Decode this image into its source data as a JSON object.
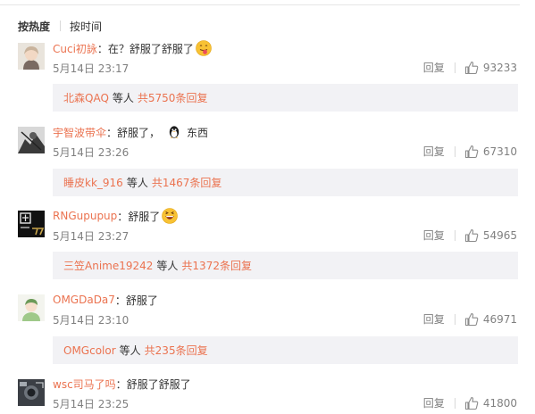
{
  "sort": {
    "hot_label": "按热度",
    "time_label": "按时间"
  },
  "colors": {
    "accent": "#eb7350",
    "text": "#333333",
    "meta": "#808080",
    "subbox_bg": "#f2f2f5"
  },
  "comments": [
    {
      "username": "Cuci初詠",
      "text": "：在？舒服了舒服了",
      "emoji": "tongue-out-emoji",
      "time": "5月14日 23:17",
      "reply_label": "回复",
      "likes": "93233",
      "sub": {
        "user": "北森QAQ",
        "deng": "等人",
        "total": "共5750条回复"
      }
    },
    {
      "username": "宇智波带伞",
      "text": "：舒服了，",
      "emoji": "qq-penguin-icon",
      "text_after": "东西",
      "time": "5月14日 23:26",
      "reply_label": "回复",
      "likes": "67310",
      "sub": {
        "user": "睡皮kk_916",
        "deng": "等人",
        "total": "共1467条回复"
      }
    },
    {
      "username": "RNGupupup",
      "text": "：舒服了",
      "emoji": "laughing-emoji",
      "time": "5月14日 23:27",
      "reply_label": "回复",
      "likes": "54965",
      "sub": {
        "user": "三笠Anime19242",
        "deng": "等人",
        "total": "共1372条回复"
      }
    },
    {
      "username": "OMGDaDa7",
      "text": "：舒服了",
      "time": "5月14日 23:10",
      "reply_label": "回复",
      "likes": "46971",
      "sub": {
        "user": "OMGcolor",
        "deng": "等人",
        "total": "共235条回复"
      }
    },
    {
      "username": "wsc司马了吗",
      "text": "：舒服了舒服了",
      "time": "5月14日 23:25",
      "reply_label": "回复",
      "likes": "41800"
    }
  ]
}
